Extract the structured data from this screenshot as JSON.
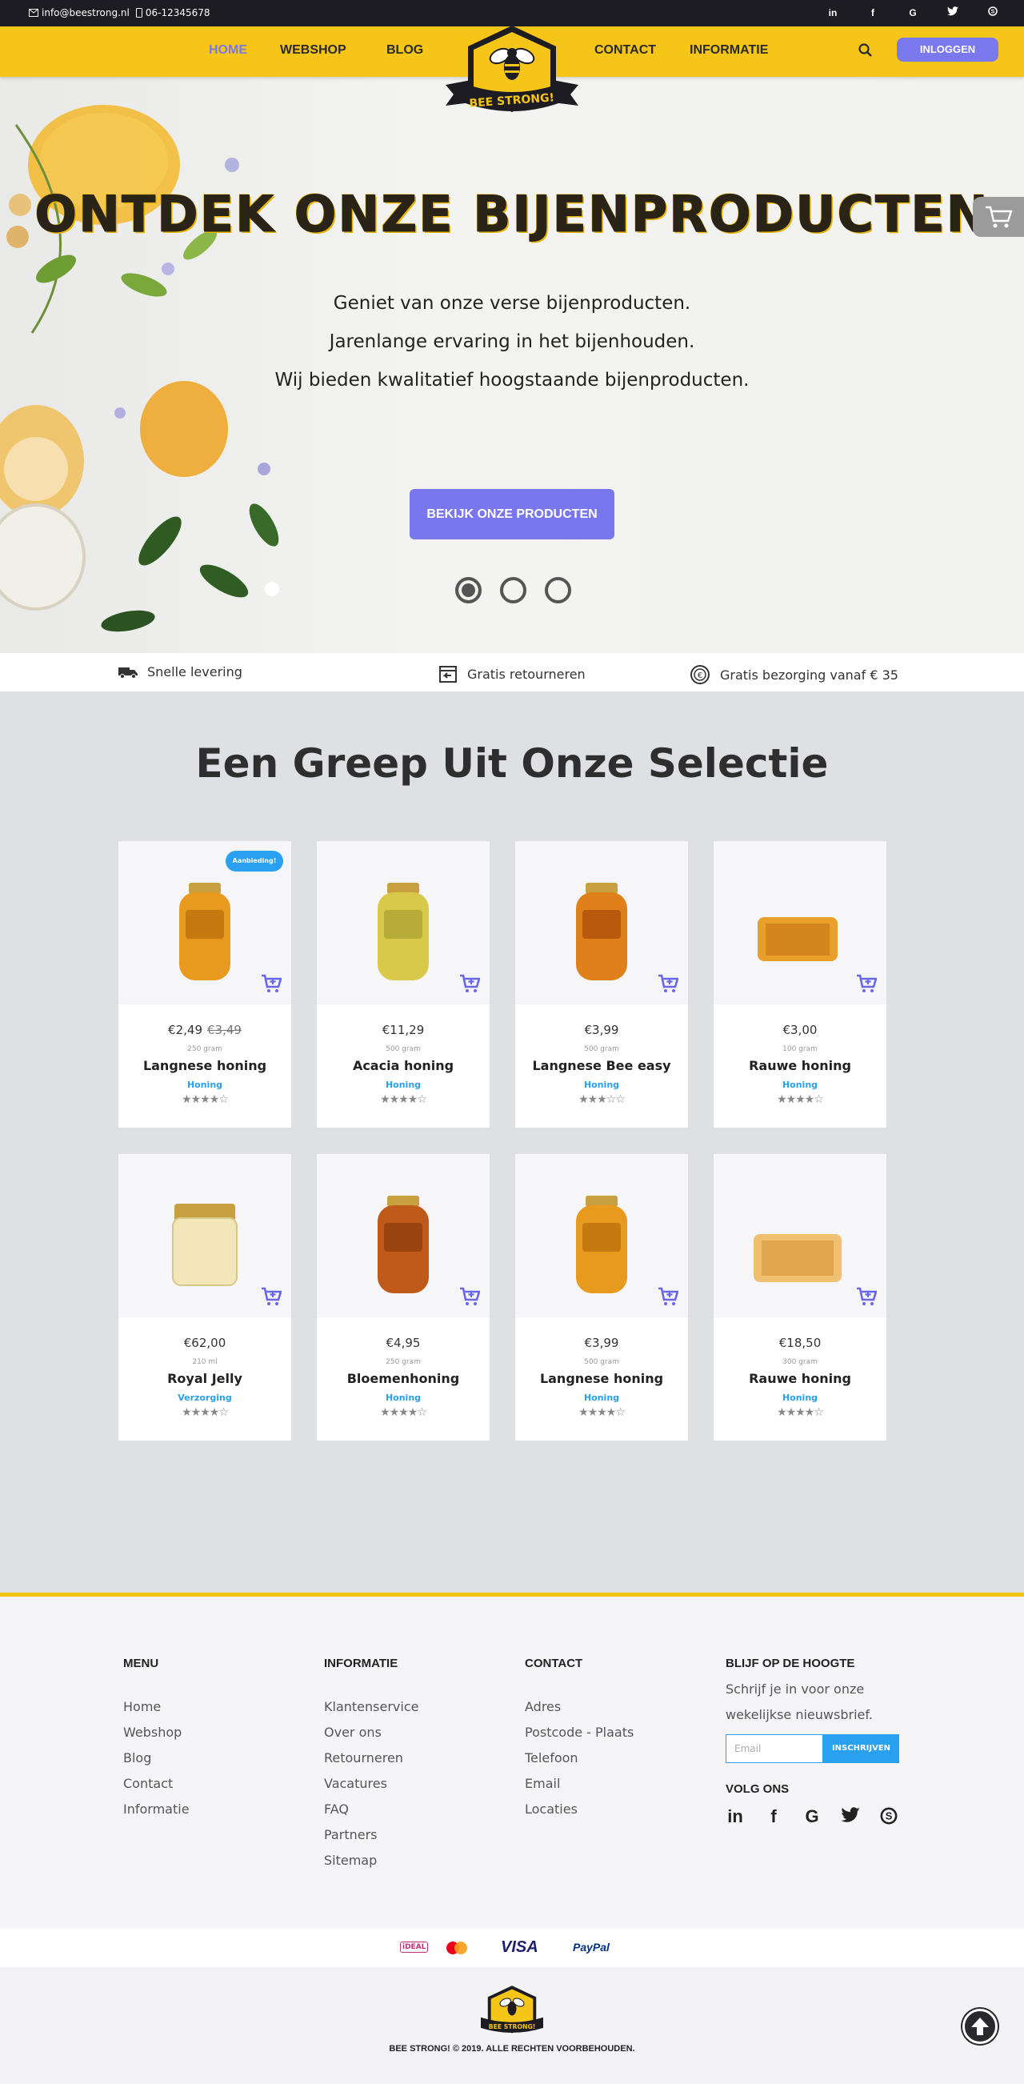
{
  "topbar": {
    "email": "info@beestrong.nl",
    "phone": "06-12345678",
    "socials": [
      "linkedin-icon",
      "facebook-icon",
      "google-icon",
      "twitter-icon",
      "skype-icon"
    ],
    "social_glyphs": [
      "in",
      "f",
      "G",
      "t",
      "S"
    ]
  },
  "nav": {
    "items": [
      "HOME",
      "WEBSHOP",
      "BLOG",
      "CONTACT",
      "INFORMATIE"
    ],
    "active": "HOME",
    "login": "INLOGGEN",
    "logo_text": "BEE STRONG!"
  },
  "hero": {
    "title": "ONTDEK ONZE BIJENPRODUCTEN",
    "lines": [
      "Geniet van onze verse bijenproducten.",
      "Jarenlange ervaring in het bijenhouden.",
      "Wij bieden kwalitatief hoogstaande bijenproducten."
    ],
    "button": "BEKIJK ONZE PRODUCTEN",
    "slides": 3,
    "active_slide": 1
  },
  "features": [
    "Snelle levering",
    "Gratis retourneren",
    "Gratis bezorging vanaf € 35"
  ],
  "selection": {
    "title": "Een Greep Uit Onze Selectie",
    "products": [
      {
        "price": "€2,49",
        "old_price": "€3,49",
        "weight": "250 gram",
        "name": "Langnese honing",
        "category": "Honing",
        "rating": 4,
        "badge": "Aanbieding!"
      },
      {
        "price": "€11,29",
        "old_price": "",
        "weight": "500 gram",
        "name": "Acacia honing",
        "category": "Honing",
        "rating": 4,
        "badge": ""
      },
      {
        "price": "€3,99",
        "old_price": "",
        "weight": "500 gram",
        "name": "Langnese Bee easy",
        "category": "Honing",
        "rating": 3,
        "badge": ""
      },
      {
        "price": "€3,00",
        "old_price": "",
        "weight": "100 gram",
        "name": "Rauwe honing",
        "category": "Honing",
        "rating": 4,
        "badge": ""
      },
      {
        "price": "€62,00",
        "old_price": "",
        "weight": "210 ml",
        "name": "Royal Jelly",
        "category": "Verzorging",
        "rating": 4,
        "badge": ""
      },
      {
        "price": "€4,95",
        "old_price": "",
        "weight": "250 gram",
        "name": "Bloemenhoning",
        "category": "Honing",
        "rating": 4,
        "badge": ""
      },
      {
        "price": "€3,99",
        "old_price": "",
        "weight": "500 gram",
        "name": "Langnese honing",
        "category": "Honing",
        "rating": 4,
        "badge": ""
      },
      {
        "price": "€18,50",
        "old_price": "",
        "weight": "300 gram",
        "name": "Rauwe honing",
        "category": "Honing",
        "rating": 4,
        "badge": ""
      }
    ]
  },
  "footer": {
    "menu": {
      "title": "MENU",
      "links": [
        "Home",
        "Webshop",
        "Blog",
        "Contact",
        "Informatie"
      ]
    },
    "info": {
      "title": "INFORMATIE",
      "links": [
        "Klantenservice",
        "Over ons",
        "Retourneren",
        "Vacatures",
        "FAQ",
        "Partners",
        "Sitemap"
      ]
    },
    "contact": {
      "title": "CONTACT",
      "links": [
        "Adres",
        "Postcode - Plaats",
        "Telefoon",
        "Email",
        "Locaties"
      ]
    },
    "newsletter": {
      "title": "BLIJF OP DE HOOGTE",
      "text": "Schrijf je in voor onze wekelijkse nieuwsbrief.",
      "placeholder": "Email",
      "button": "INSCHRIJVEN",
      "follow": "VOLG ONS"
    },
    "payments": [
      "iDEAL",
      "Mastercard",
      "VISA",
      "PayPal"
    ],
    "copyright": "BEE STRONG! © 2019. ALLE RECHTEN VOORBEHOUDEN."
  },
  "colors": {
    "yellow": "#f5c518",
    "purple": "#7b78ee",
    "blue": "#2aa0f0",
    "dark": "#1c1c22"
  }
}
